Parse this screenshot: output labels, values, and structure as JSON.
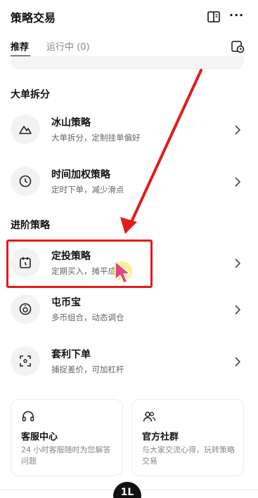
{
  "header": {
    "title": "策略交易",
    "more_label": "···"
  },
  "tabs": [
    {
      "label": "推荐"
    },
    {
      "label": "运行中 (0)"
    }
  ],
  "sections": [
    {
      "title": "大单拆分",
      "items": [
        {
          "name": "冰山策略",
          "desc": "大单拆分，定制挂单偏好",
          "icon": "mountain-icon"
        },
        {
          "name": "时间加权策略",
          "desc": "定时下单，减少滑点",
          "icon": "clock-icon"
        }
      ]
    },
    {
      "title": "进阶策略",
      "items": [
        {
          "name": "定投策略",
          "desc": "定期买入，摊平成本",
          "icon": "calendar-clock-icon"
        },
        {
          "name": "屯币宝",
          "desc": "多币组合，动态调仓",
          "icon": "coin-icon"
        },
        {
          "name": "套利下单",
          "desc": "捕捉差价，可加杠杆",
          "icon": "scan-icon"
        }
      ]
    }
  ],
  "info_cards": [
    {
      "title": "客服中心",
      "desc": "24 小时客服随时为您解答问题",
      "icon": "headset-icon"
    },
    {
      "title": "官方社群",
      "desc": "与大家交流心得，玩转策略交易",
      "icon": "community-icon"
    }
  ],
  "bottom": {
    "badge": "1L"
  },
  "colors": {
    "highlight": "#e21b1b",
    "text": "#111111",
    "muted": "#666666"
  }
}
